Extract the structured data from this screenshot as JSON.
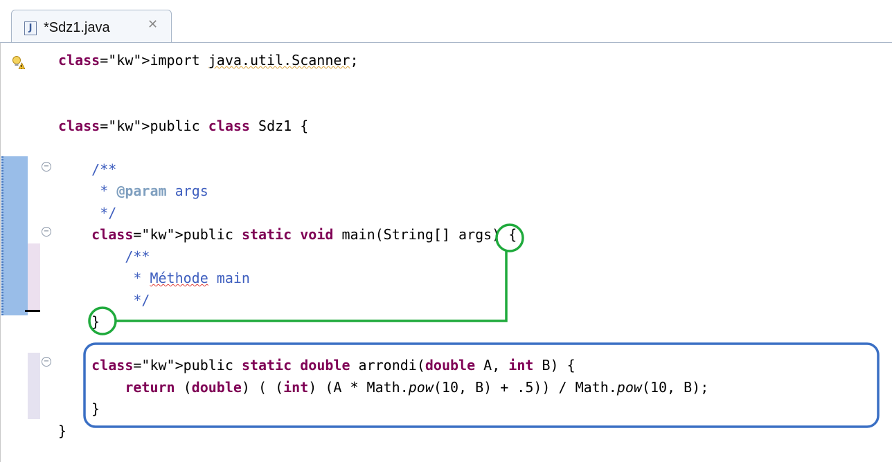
{
  "tab": {
    "file_icon": "J",
    "title": "*Sdz1.java",
    "close_glyph": "✕"
  },
  "code": {
    "line_import": "import java.util.Scanner;",
    "line_class": "public class Sdz1 {",
    "line_jd_open": "/**",
    "line_param_tag": "@param",
    "line_param_name": "args",
    "line_jd_close": "*/",
    "line_main_sig": "public static void main(String[] args) {",
    "line_inner_open": "/**",
    "line_methode": "Méthode",
    "line_methode_rest": "main",
    "line_inner_close": "*/",
    "line_main_close": "}",
    "line_arrondi_sig": "public static double arrondi(double A, int B) {",
    "line_return": "return (double) ( (int) (A * Math.pow(10, B) + .5)) / Math.pow(10, B);",
    "line_arrondi_close": "}",
    "line_class_close": "}"
  },
  "icons": {
    "gutter_warning": "lightbulb-warning-icon",
    "fold": "fold-collapse-icon"
  },
  "colors": {
    "keyword": "#7f0055",
    "javadoc": "#3f5fbf",
    "javadoc_tag": "#7f9fbf",
    "brace_highlight": "#1faa3c",
    "method_box": "#3a6fc4"
  }
}
